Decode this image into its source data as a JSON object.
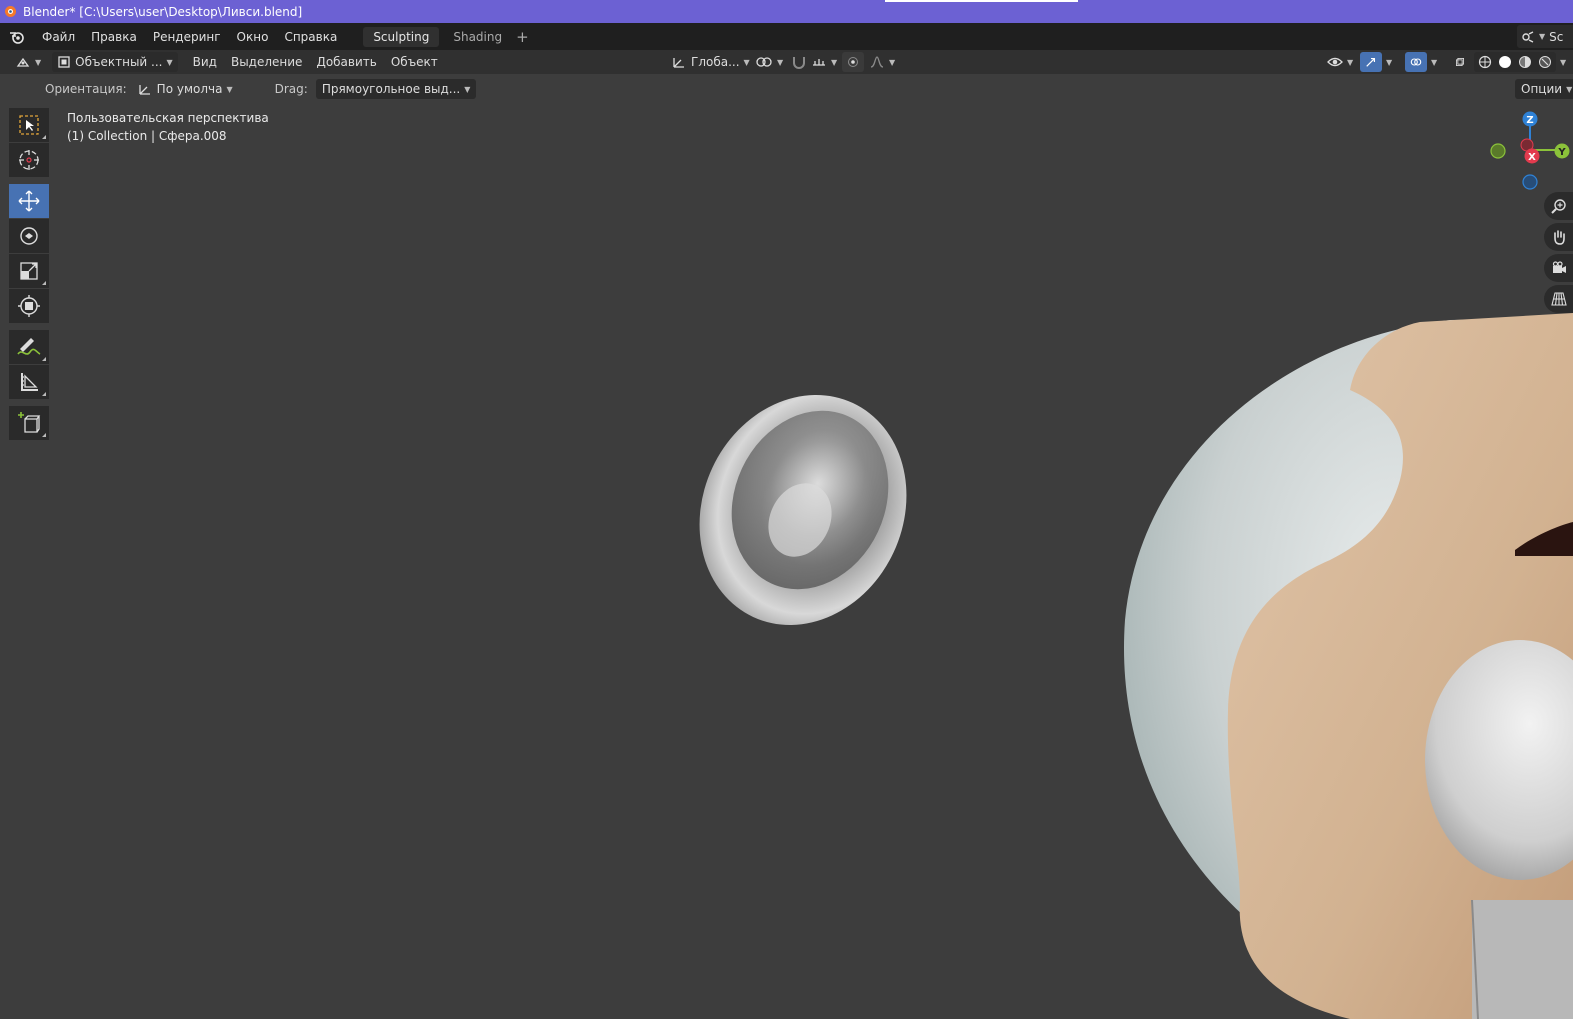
{
  "titlebar": {
    "title": "Blender* [C:\\Users\\user\\Desktop\\Ливси.blend]"
  },
  "menu": [
    "Файл",
    "Правка",
    "Рендеринг",
    "Окно",
    "Справка"
  ],
  "workspaces": {
    "tabs": [
      "Sculpting",
      "Shading"
    ],
    "active": "Sculpting",
    "add": "+"
  },
  "scene_button": {
    "label": "Sc"
  },
  "header": {
    "mode": "Объектный ...",
    "menus": [
      "Вид",
      "Выделение",
      "Добавить",
      "Объект"
    ],
    "transform_orientation": "Глоба..."
  },
  "tool_settings": {
    "orientation_label": "Ориентация:",
    "orientation_value": "По умолча",
    "drag_label": "Drag:",
    "drag_value": "Прямоугольное выд...",
    "options_label": "Опции"
  },
  "viewport": {
    "view_name": "Пользовательская перспектива",
    "collection_info": "(1) Collection | Сфера.008"
  },
  "gizmo": {
    "z": "Z",
    "y": "Y",
    "x": "X"
  },
  "tools": [
    "select-box-icon",
    "cursor-icon",
    "move-icon",
    "rotate-icon",
    "scale-icon",
    "transform-icon",
    "annotate-icon",
    "measure-icon",
    "add-cube-icon"
  ],
  "colors": {
    "titlebar": "#6c61d3",
    "active_tool": "#4772b3",
    "viewport_bg": "#3d3d3d",
    "x_axis": "#e33b4e",
    "y_axis": "#8bc23a",
    "z_axis": "#2f82d6"
  }
}
